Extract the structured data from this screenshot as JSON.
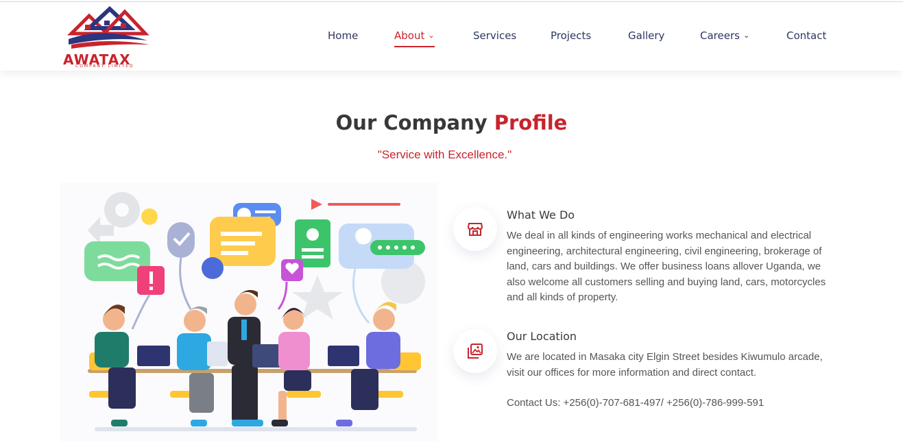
{
  "brand": {
    "name": "AWATAX",
    "tagline": "COMPANY LIMITED"
  },
  "nav": {
    "items": [
      {
        "label": "Home"
      },
      {
        "label": "About",
        "active": true,
        "dropdown": true
      },
      {
        "label": "Services"
      },
      {
        "label": "Projects"
      },
      {
        "label": "Gallery"
      },
      {
        "label": "Careers",
        "dropdown": true
      },
      {
        "label": "Contact"
      }
    ]
  },
  "section": {
    "title_main": "Our Company",
    "title_accent": "Profile",
    "subtitle": "\"Service with Excellence.\""
  },
  "features": [
    {
      "icon": "store-icon",
      "title": "What We Do",
      "text": "We deal in all kinds of engineering works mechanical and electrical engineering, architectural engineering, civil engineering, brokerage of land, cars and buildings. We offer business loans allover Uganda, we also welcome all customers selling and buying land, cars, motorcycles and all kinds of property."
    },
    {
      "icon": "gallery-icon",
      "title": "Our Location",
      "text": "We are located in Masaka city Elgin Street besides Kiwumulo arcade, visit our offices for more information and direct contact.",
      "contact": "Contact Us: +256(0)-707-681-497/ +256(0)-786-999-591"
    }
  ],
  "colors": {
    "accent": "#c8232c",
    "nav_text": "#2c3560",
    "heading": "#383838"
  }
}
